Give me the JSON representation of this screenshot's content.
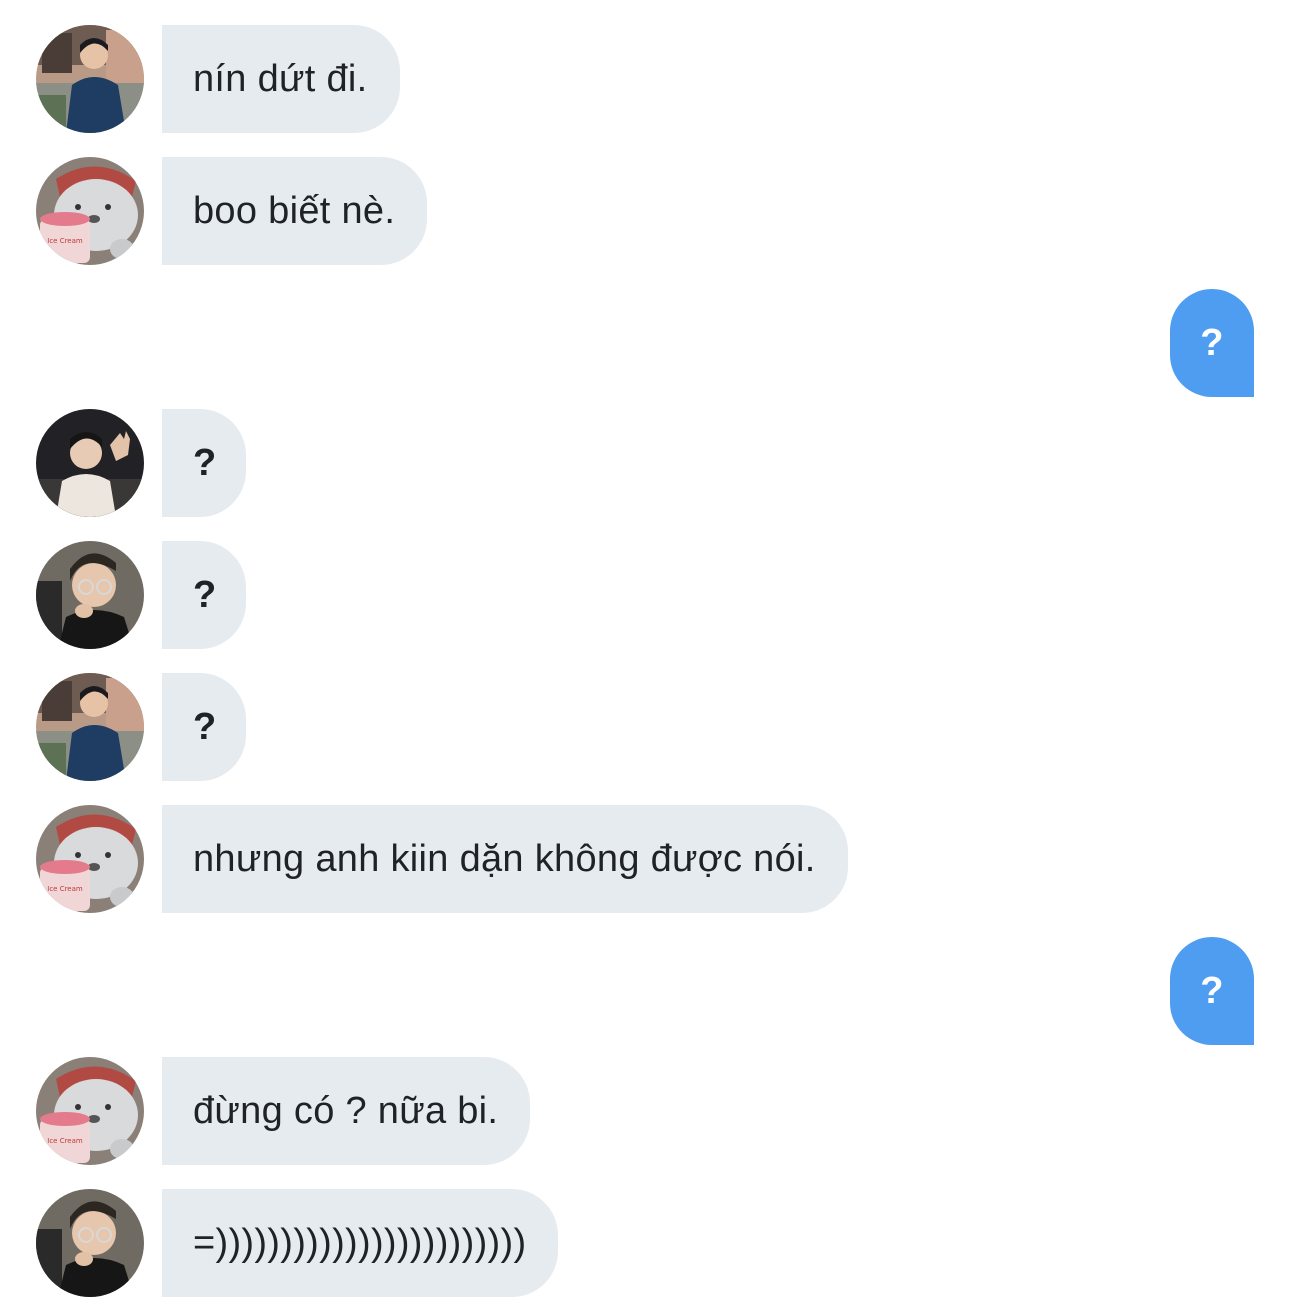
{
  "conversation": {
    "messages": [
      {
        "sender": "avatar-street",
        "direction": "incoming",
        "text": "nín dứt đi."
      },
      {
        "sender": "avatar-bear",
        "direction": "incoming",
        "text": "boo biết nè."
      },
      {
        "sender": "me",
        "direction": "outgoing",
        "text": "?"
      },
      {
        "sender": "avatar-dark",
        "direction": "incoming",
        "text": "?"
      },
      {
        "sender": "avatar-glasses",
        "direction": "incoming",
        "text": "?"
      },
      {
        "sender": "avatar-street",
        "direction": "incoming",
        "text": "?"
      },
      {
        "sender": "avatar-bear",
        "direction": "incoming",
        "text": "nhưng anh kiin dặn không được nói."
      },
      {
        "sender": "me",
        "direction": "outgoing",
        "text": "?"
      },
      {
        "sender": "avatar-bear",
        "direction": "incoming",
        "text": "đừng có ? nữa bi."
      },
      {
        "sender": "avatar-glasses",
        "direction": "incoming",
        "text": "=))))))))))))))))))))))))"
      }
    ]
  },
  "colors": {
    "incoming_bubble": "#e6ebf0",
    "outgoing_bubble": "#4e9df0",
    "text": "#1f2328"
  }
}
